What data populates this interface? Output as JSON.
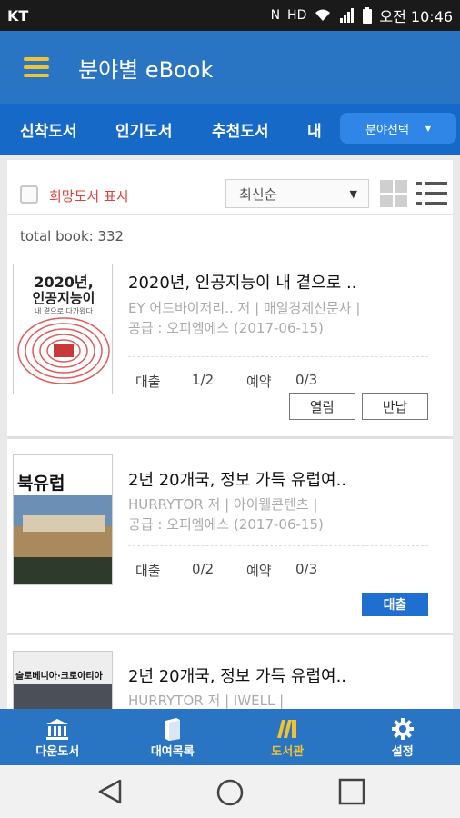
{
  "status_bar": {
    "carrier": "KT",
    "time": "오전 10:46",
    "icons": [
      "nfc-icon",
      "hd-icon",
      "wifi-icon",
      "signal-icon",
      "battery-icon"
    ]
  },
  "app_bar": {
    "title": "분야별 eBook",
    "menu_icon": "hamburger-icon"
  },
  "tabs": [
    {
      "label": "신착도서"
    },
    {
      "label": "인기도서"
    },
    {
      "label": "추천도서"
    },
    {
      "label": "내"
    }
  ],
  "category_select": {
    "label": "분야선택"
  },
  "filter": {
    "wish_label": "희망도서 표시",
    "wish_checked": false,
    "sort_value": "최신순"
  },
  "total_label": "total book: 332",
  "books": [
    {
      "title": "2020년, 인공지능이 내 곁으로 ..",
      "author": "EY 어드바이저리.. 저",
      "publisher": "매일경제신문사",
      "supplier": "공급 : 오피엠에스 (2017-06-15)",
      "loan_label": "대출",
      "loan_value": "1/2",
      "reserve_label": "예약",
      "reserve_value": "0/3",
      "actions": [
        "열람",
        "반납"
      ],
      "cover": {
        "line1": "2020년,",
        "line2": "인공지능이",
        "line3": "내 곁으로 다가왔다"
      }
    },
    {
      "title": "2년 20개국, 정보 가득 유럽여..",
      "author": "HURRYTOR 저",
      "publisher": "아이웰콘텐츠",
      "supplier": "공급 : 오피엠에스 (2017-06-15)",
      "loan_label": "대출",
      "loan_value": "0/2",
      "reserve_label": "예약",
      "reserve_value": "0/3",
      "actions": [
        "대출"
      ],
      "cover": {
        "line1": "북유럽"
      }
    },
    {
      "title": "2년 20개국, 정보 가득 유럽여..",
      "author": "HURRYTOR 저",
      "publisher": "IWELL",
      "cover": {
        "line1": "슬로베니아·크로아티아"
      }
    }
  ],
  "bottom_nav": [
    {
      "label": "다운도서",
      "icon": "library-icon",
      "active": false
    },
    {
      "label": "대여목록",
      "icon": "book-icon",
      "active": false
    },
    {
      "label": "도서관",
      "icon": "books-shelf-icon",
      "active": true
    },
    {
      "label": "설정",
      "icon": "gear-icon",
      "active": false
    }
  ],
  "colors": {
    "primary": "#2a74c4",
    "tab_bar": "#1769c7",
    "accent_yellow": "#f1c232",
    "wish_red": "#e0403a",
    "button_blue": "#1f6fd0"
  }
}
